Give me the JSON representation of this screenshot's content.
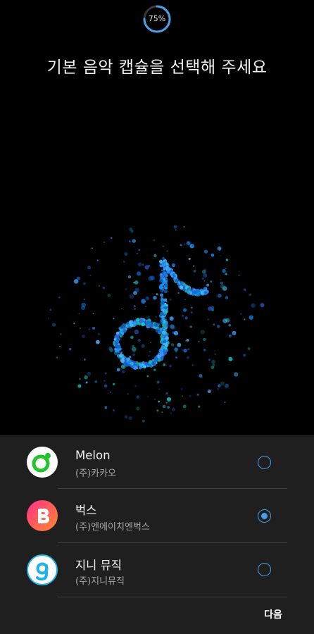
{
  "progress": {
    "value": 75,
    "label": "75%"
  },
  "title": "기본 음악 캡슐을 선택해 주세요",
  "apps": [
    {
      "name": "Melon",
      "company": "(주)카카오",
      "selected": false,
      "icon": "melon-logo-icon"
    },
    {
      "name": "벅스",
      "company": "(주)엔에이치엔벅스",
      "selected": true,
      "icon": "bugs-logo-icon"
    },
    {
      "name": "지니 뮤직",
      "company": "(주)지니뮤직",
      "selected": false,
      "icon": "genie-logo-icon"
    }
  ],
  "next_label": "다음",
  "colors": {
    "accent": "#4a9fe6",
    "sheet_background": "#1f1f1f",
    "melon_green": "#22c52e",
    "bugs_gradient": [
      "#ff3d6e",
      "#ff8a2b"
    ],
    "genie_blue": "#1fb3e8"
  }
}
